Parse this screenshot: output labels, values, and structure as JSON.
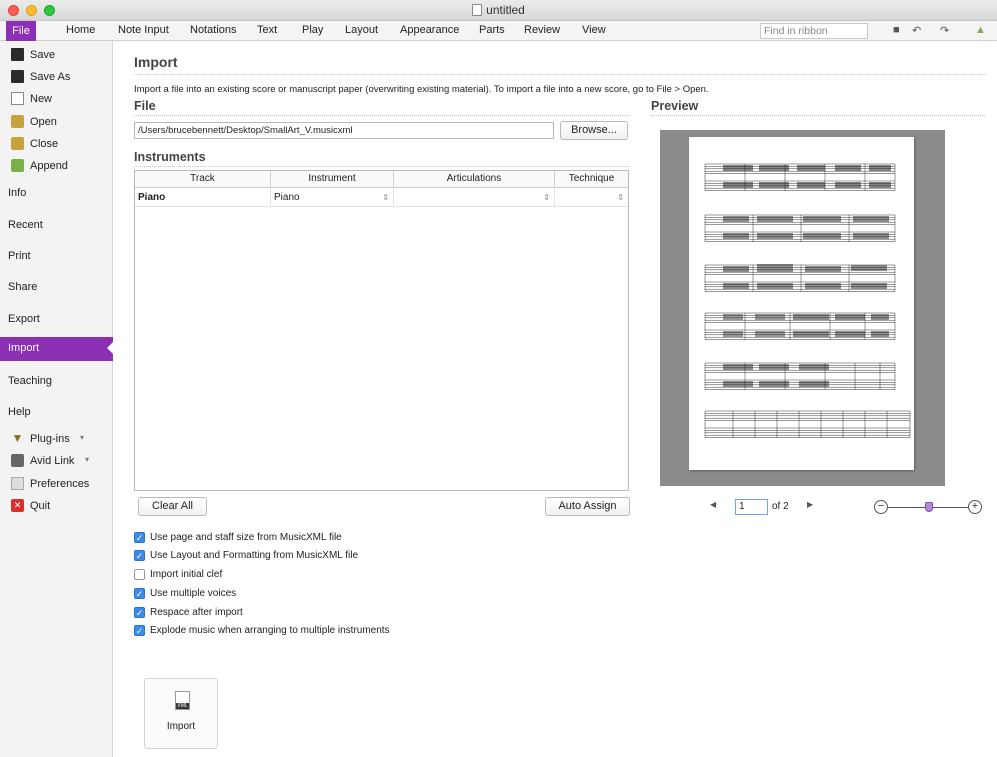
{
  "window": {
    "title": "untitled"
  },
  "ribbon": {
    "tabs": [
      "File",
      "Home",
      "Note Input",
      "Notations",
      "Text",
      "Play",
      "Layout",
      "Appearance",
      "Parts",
      "Review",
      "View"
    ],
    "find_placeholder": "Find in ribbon"
  },
  "sidebar": {
    "items": [
      {
        "label": "Save",
        "icon": "save-icon"
      },
      {
        "label": "Save As",
        "icon": "save-as-icon"
      },
      {
        "label": "New",
        "icon": "new-icon"
      },
      {
        "label": "Open",
        "icon": "open-icon"
      },
      {
        "label": "Close",
        "icon": "close-folder-icon"
      },
      {
        "label": "Append",
        "icon": "append-icon"
      },
      {
        "label": "Info"
      },
      {
        "label": "Recent"
      },
      {
        "label": "Print"
      },
      {
        "label": "Share"
      },
      {
        "label": "Export"
      },
      {
        "label": "Import",
        "active": true
      },
      {
        "label": "Teaching"
      },
      {
        "label": "Help"
      },
      {
        "label": "Plug-ins",
        "icon": "plugins-icon"
      },
      {
        "label": "Avid Link",
        "icon": "avid-link-icon"
      },
      {
        "label": "Preferences",
        "icon": "preferences-icon"
      },
      {
        "label": "Quit",
        "icon": "quit-icon"
      }
    ]
  },
  "main": {
    "title": "Import",
    "description": "Import a file into an existing score or manuscript paper (overwriting existing material). To import a file into a new score, go to File > Open.",
    "file_heading": "File",
    "file_path": "/Users/brucebennett/Desktop/SmallArt_V.musicxml",
    "browse_label": "Browse...",
    "instruments_heading": "Instruments",
    "table": {
      "columns": [
        "Track",
        "Instrument",
        "Articulations",
        "Technique"
      ],
      "rows": [
        {
          "track": "Piano",
          "instrument": "Piano",
          "articulations": "",
          "technique": ""
        }
      ]
    },
    "clear_all_label": "Clear All",
    "auto_assign_label": "Auto Assign",
    "options": [
      {
        "label": "Use page and staff size from MusicXML file",
        "checked": true
      },
      {
        "label": "Use Layout and Formatting from MusicXML file",
        "checked": true
      },
      {
        "label": "Import initial clef",
        "checked": false
      },
      {
        "label": "Use multiple voices",
        "checked": true
      },
      {
        "label": "Respace after import",
        "checked": true
      },
      {
        "label": "Explode music when arranging to multiple instruments",
        "checked": true
      }
    ],
    "import_button_label": "Import"
  },
  "preview": {
    "heading": "Preview",
    "page": "1",
    "of_label": "of 2"
  },
  "colors": {
    "accent": "#8b2fb5",
    "checkbox": "#3b8bea"
  }
}
